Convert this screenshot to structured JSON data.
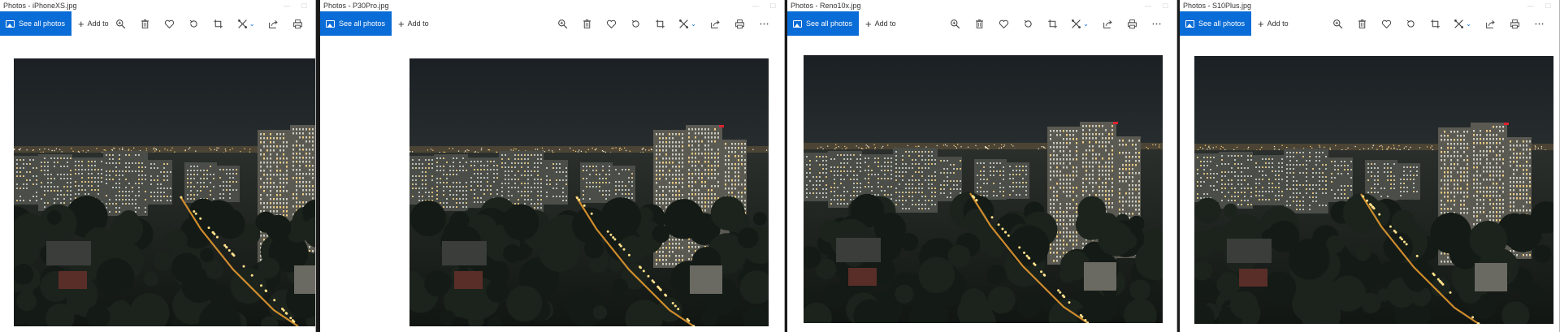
{
  "windows": [
    {
      "title": "Photos - iPhoneXS.jpg"
    },
    {
      "title": "Photos - P30Pro.jpg"
    },
    {
      "title": "Photos - Reno10x.jpg"
    },
    {
      "title": "Photos - S10Plus.jpg"
    }
  ],
  "toolbar": {
    "see_all_label": "See all photos",
    "add_to_label": "Add to"
  },
  "icons": [
    "picture-icon",
    "plus-icon",
    "zoom-icon",
    "delete-icon",
    "heart-icon",
    "rotate-icon",
    "crop-icon",
    "edit-icon",
    "share-icon",
    "print-icon",
    "more-icon"
  ],
  "colors": {
    "accent": "#0a6cd6",
    "sky_top": "#1b2024",
    "sky_bottom": "#3a3f3e"
  }
}
